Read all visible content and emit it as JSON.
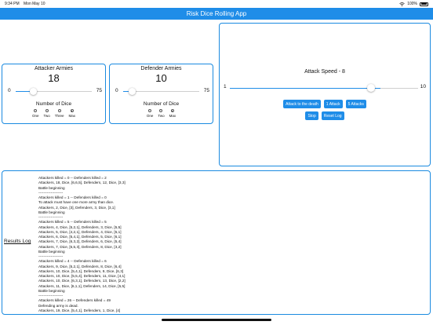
{
  "status": {
    "time": "9:34 PM",
    "date": "Mon May 10",
    "battery": "100%"
  },
  "app": {
    "title": "Risk Dice Rolling App"
  },
  "attacker": {
    "title": "Attacker Armies",
    "count": "18",
    "slider": {
      "min": "0",
      "max": "75",
      "value": 18
    },
    "dice_label": "Number of Dice",
    "options": [
      "One",
      "Two",
      "Three",
      "Max"
    ],
    "selected": "Max"
  },
  "defender": {
    "title": "Defender Armies",
    "count": "10",
    "slider": {
      "min": "0",
      "max": "75",
      "value": 10
    },
    "dice_label": "Number of Dice",
    "options": [
      "One",
      "Two",
      "Max"
    ],
    "selected": "Max"
  },
  "speed": {
    "label": "Attack Speed - 8",
    "slider": {
      "min": "1",
      "max": "10",
      "value": 8
    },
    "buttons": {
      "attack_death": "Attack to the death",
      "one_attack": "1 Attack",
      "five_attacks": "5 Attacks",
      "stop": "Stop",
      "reset_log": "Reset Log"
    }
  },
  "results": {
    "label": "Results Log",
    "lines": [
      "Attackers killed = 0 -- Defenders killed = 2",
      "Attackers, 18, Dice, [6,6,5], Defenders, 12, Dice, [3,3]",
      "Battle beginning",
      "--------------------",
      "Attackers killed = 1 -- Defenders killed = 0",
      "To attack must have one more army than dice.",
      "Attackers, 2, Dice, [3], Defenders, 3, Dice, [3,1]",
      "Battle beginning",
      "--------------------",
      "Attackers killed = 5 -- Defenders killed = 5",
      "Attackers, 4, Dice, [5,2,1], Defenders, 3, Dice, [5,5]",
      "Attackers, 5, Dice, [4,2,1], Defenders, 4, Dice, [5,1]",
      "Attackers, 6, Dice, [5,4,1], Defenders, 5, Dice, [6,1]",
      "Attackers, 7, Dice, [6,3,2], Defenders, 6, Dice, [5,4]",
      "Attackers, 7, Dice, [6,5,3], Defenders, 8, Dice, [3,2]",
      "Battle beginning",
      "--------------------",
      "Attackers killed = 4 -- Defenders killed = 6",
      "Attackers, 9, Dice, [5,2,1], Defenders, 8, Dice, [6,4]",
      "Attackers, 10, Dice, [5,4,1], Defenders, 9, Dice, [6,3]",
      "Attackers, 10, Dice, [5,5,4], Defenders, 11, Dice, [4,1]",
      "Attackers, 10, Dice, [6,3,1], Defenders, 13, Dice, [2,2]",
      "Attackers, 11, Dice, [6,1,1], Defenders, 14, Dice, [5,5]",
      "Battle beginning",
      "--------------------",
      "Attackers killed = 26 -- Defenders killed = 49",
      "Defending army is dead.",
      "Attackers, 19, Dice, [5,4,1], Defenders, 1, Dice, [4]"
    ]
  }
}
